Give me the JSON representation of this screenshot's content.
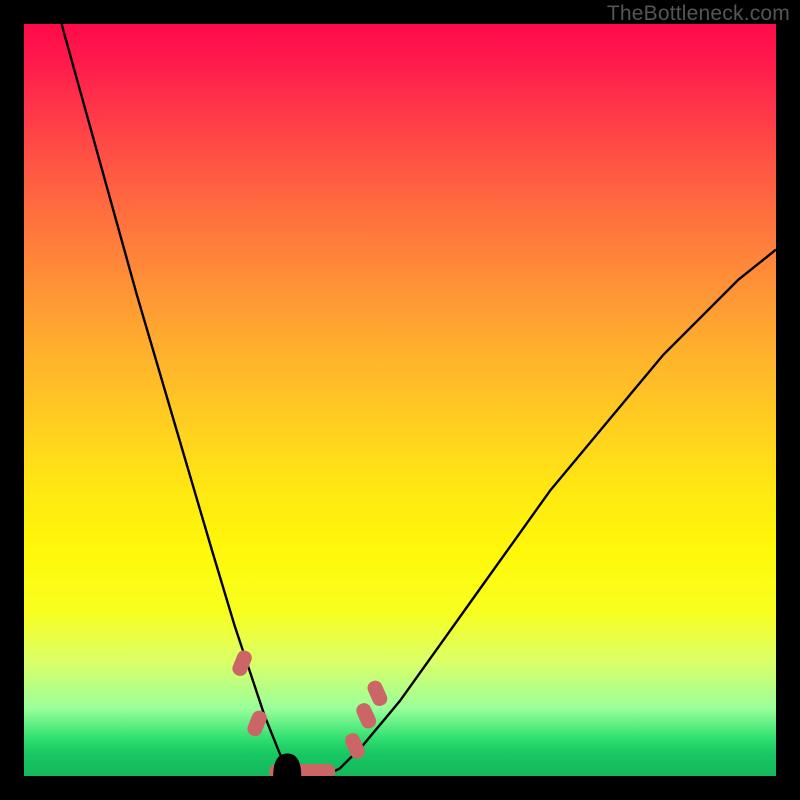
{
  "watermark": "TheBottleneck.com",
  "chart_data": {
    "type": "line",
    "title": "",
    "xlabel": "",
    "ylabel": "",
    "xlim": [
      0,
      100
    ],
    "ylim": [
      0,
      100
    ],
    "grid": false,
    "legend": null,
    "background_scale": {
      "top_color": "#ff0a4a",
      "mid_color": "#fff000",
      "bottom_color": "#18c862",
      "meaning": "vertical position encodes bottleneck severity: top=red=bad, bottom=green=good"
    },
    "series": [
      {
        "name": "bottleneck-curve",
        "color": "#000000",
        "x": [
          5,
          10,
          15,
          20,
          25,
          28,
          30,
          32,
          34,
          35,
          36,
          38,
          40,
          42,
          45,
          50,
          55,
          60,
          65,
          70,
          75,
          80,
          85,
          90,
          95,
          100
        ],
        "y": [
          100,
          82,
          64,
          47,
          30,
          20,
          14,
          8,
          3,
          1,
          0,
          0,
          0,
          1,
          4,
          10,
          17,
          24,
          31,
          38,
          44,
          50,
          56,
          61,
          66,
          70
        ]
      }
    ],
    "markers": [
      {
        "name": "data-point-left-upper",
        "shape": "rounded-rect",
        "color": "#cc6666",
        "x": 29,
        "y": 15
      },
      {
        "name": "data-point-left-lower",
        "shape": "rounded-rect",
        "color": "#cc6666",
        "x": 31,
        "y": 7
      },
      {
        "name": "data-point-floor-segment",
        "shape": "rounded-rect-long",
        "color": "#cc6666",
        "x": 37,
        "y": 0
      },
      {
        "name": "data-point-right-lower",
        "shape": "rounded-rect",
        "color": "#cc6666",
        "x": 44,
        "y": 4
      },
      {
        "name": "data-point-right-mid",
        "shape": "rounded-rect",
        "color": "#cc6666",
        "x": 45.5,
        "y": 8
      },
      {
        "name": "data-point-right-upper",
        "shape": "rounded-rect",
        "color": "#cc6666",
        "x": 47,
        "y": 11
      }
    ],
    "notch": {
      "x": 35,
      "depth": 5,
      "note": "small dip in bottom edge of plot near curve minimum"
    }
  }
}
